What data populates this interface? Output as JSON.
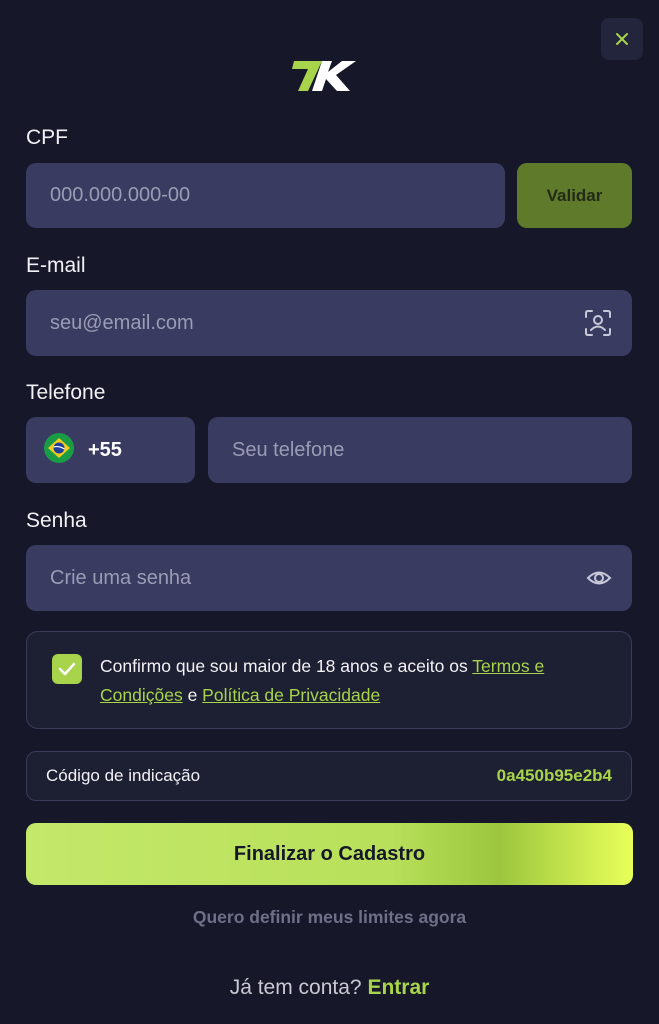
{
  "header": {
    "close_icon": "close-icon",
    "logo_text": "7K"
  },
  "cpf": {
    "label": "CPF",
    "placeholder": "000.000.000-00",
    "validate_label": "Validar"
  },
  "email": {
    "label": "E-mail",
    "placeholder": "seu@email.com",
    "icon": "face-scan-icon"
  },
  "phone": {
    "label": "Telefone",
    "country_flag": "brazil-flag-icon",
    "country_code": "+55",
    "placeholder": "Seu telefone"
  },
  "password": {
    "label": "Senha",
    "placeholder": "Crie uma senha",
    "icon": "eye-icon"
  },
  "terms": {
    "checked": true,
    "text_before": "Confirmo que sou maior de 18 anos e aceito os ",
    "terms_link": "Termos e Condições",
    "text_middle": " e ",
    "privacy_link": "Política de Privacidade"
  },
  "referral": {
    "label": "Código de indicação",
    "code": "0a450b95e2b4"
  },
  "actions": {
    "submit_label": "Finalizar o Cadastro",
    "limits_label": "Quero definir meus limites agora",
    "login_prompt": "Já tem conta?",
    "login_label": "Entrar"
  },
  "colors": {
    "background": "#16182a",
    "field": "#3a3b60",
    "accent": "#a7d44a",
    "validate_button": "#5e7a2a"
  }
}
